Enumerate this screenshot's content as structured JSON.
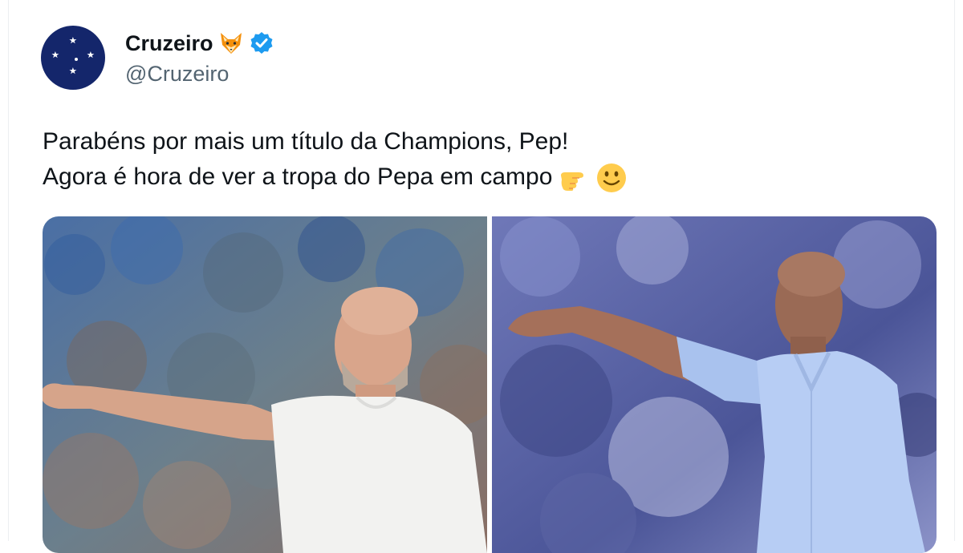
{
  "tweet": {
    "author": {
      "display_name": "Cruzeiro",
      "handle": "@Cruzeiro",
      "name_emoji": "fox-emoji",
      "verified": true,
      "avatar_icon": "cruzeiro-crest-stars",
      "avatar_color": "#1a2a6c"
    },
    "text_lines": [
      "Parabéns por mais um título da Champions, Pep!",
      "Agora é hora de ver a tropa do Pepa em campo"
    ],
    "line2_emojis": [
      "pointing-right-emoji",
      "smiling-face-emoji"
    ],
    "media": [
      {
        "icon": "photo-coach-white-shirt-pointing"
      },
      {
        "icon": "photo-coach-blue-shirt-pointing"
      }
    ]
  },
  "colors": {
    "verified_blue": "#1d9bf0",
    "text_primary": "#0f1419",
    "text_secondary": "#536471"
  }
}
